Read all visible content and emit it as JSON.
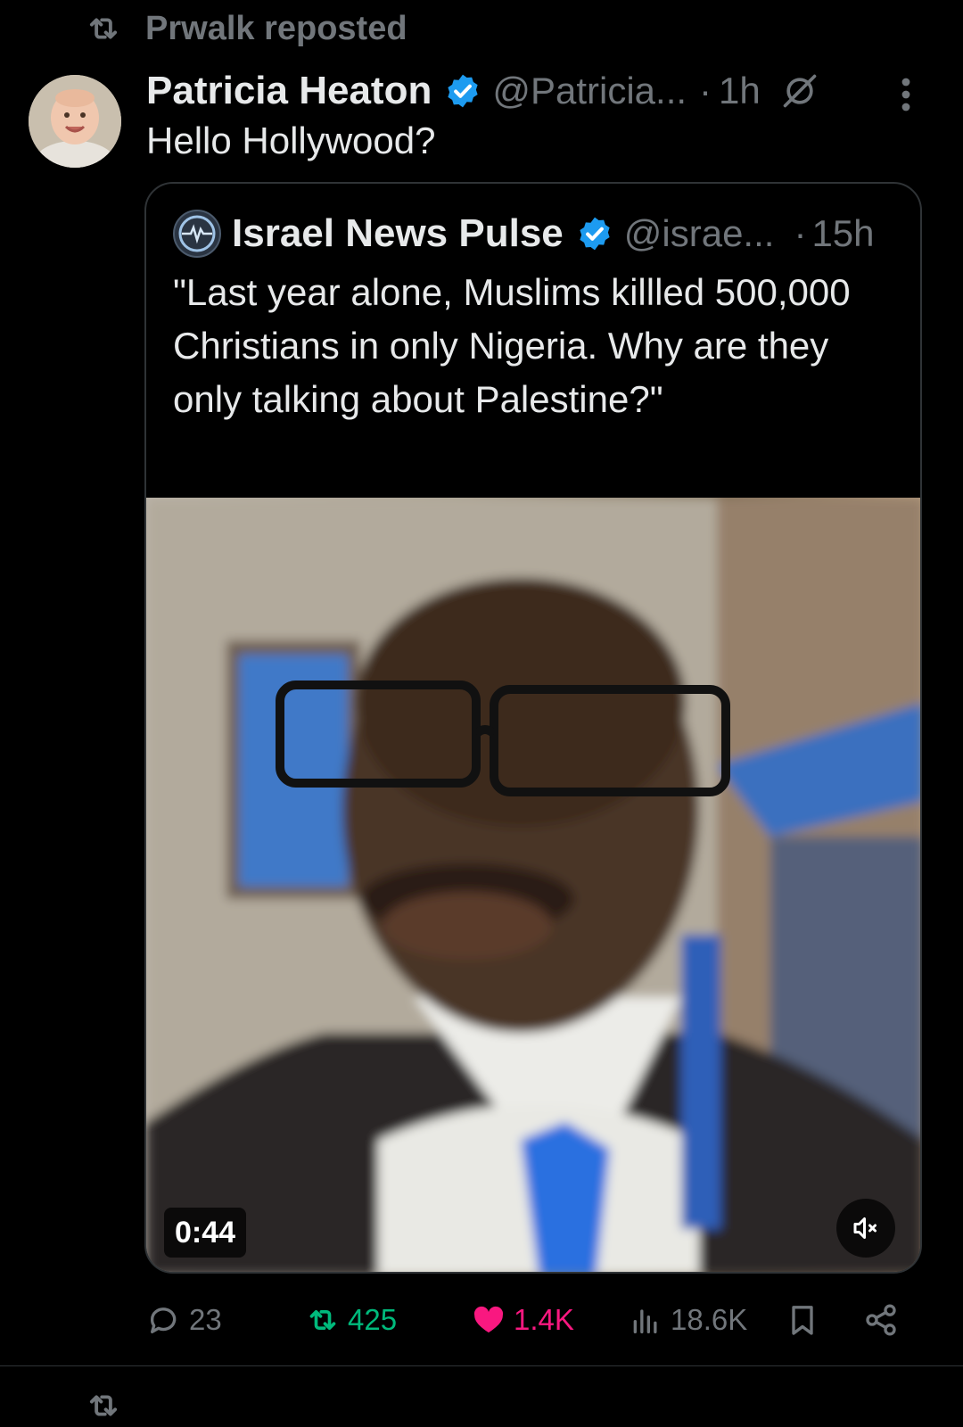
{
  "repost_banner": {
    "text": "Prwalk reposted"
  },
  "post": {
    "author_name": "Patricia Heaton",
    "handle": "@Patricia...",
    "separator": "·",
    "time": "1h",
    "text": "Hello Hollywood?"
  },
  "quoted_post": {
    "author_name": "Israel News Pulse",
    "handle": "@israe...",
    "separator": "·",
    "time": "15h",
    "text": "\"Last year alone, Muslims killled 500,000 Christians in only Nigeria. Why are they only talking about Palestine?\"",
    "media": {
      "type": "video",
      "duration": "0:44",
      "muted": true
    }
  },
  "actions": {
    "replies": "23",
    "reposts": "425",
    "likes": "1.4K",
    "views": "18.6K"
  },
  "colors": {
    "background": "#000000",
    "primary_text": "#e7e9ea",
    "secondary_text": "#71767b",
    "verified_blue": "#1d9bf0",
    "repost_green": "#00ba7c",
    "like_pink": "#f91880",
    "border": "#2f3336"
  },
  "icons": [
    "repost-icon",
    "verified-badge-icon",
    "muted-conversation-icon",
    "more-options-icon",
    "reply-icon",
    "like-icon",
    "views-icon",
    "bookmark-icon",
    "share-icon",
    "volume-muted-icon"
  ]
}
